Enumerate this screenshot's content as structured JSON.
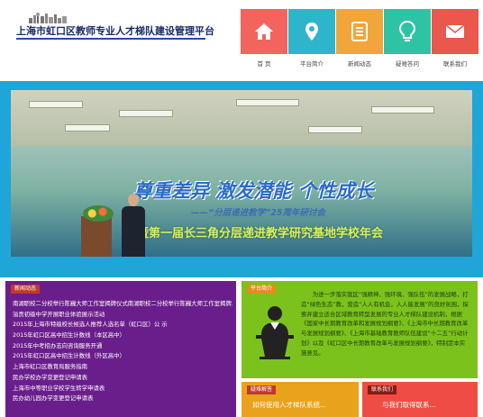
{
  "header": {
    "title": "上海市虹口区教师专业人才梯队建设管理平台"
  },
  "nav": [
    {
      "label": "首 页",
      "icon": "home-icon",
      "color": "#f4645f"
    },
    {
      "label": "平台简介",
      "icon": "location-pin-icon",
      "color": "#2fb5c9"
    },
    {
      "label": "新闻动态",
      "icon": "document-icon",
      "color": "#f2a53a"
    },
    {
      "label": "疑难答问",
      "icon": "lightbulb-icon",
      "color": "#2fc3a6"
    },
    {
      "label": "联系我们",
      "icon": "envelope-icon",
      "color": "#e9574d"
    }
  ],
  "banner": {
    "slogan": "尊重差异 激发潜能 个性成长",
    "subtitle": "——“分层递进教学”25周年研讨会",
    "line3": "暨第一届长三角分层递进教学研究基地学校年会"
  },
  "news": {
    "tag": "新闻动态",
    "items": [
      "南湖职校二分校举行陈巍大师工作室揭牌仪式南湖职校二分校举行陈巍大师工作室揭牌...",
      "溢贡初级中学开展职业体验展示活动",
      "2015年上海市特级校长候选人推荐人选名单（虹口区）公 示",
      "2015年虹口区高中招生计数线（本区高中）",
      "2015年中考招办志向咨询服务开通",
      "2015年虹口区高中招生计数线（外区高中）",
      "上海市虹口区教育局服务指南",
      "民办学校办学变更登记申请表",
      "上海市中等职业学校学生转学申请表",
      "民办幼儿园办学变更登记申请表"
    ]
  },
  "intro": {
    "tag": "平台简介",
    "text": "为进一步落实我区“强精神、强环境、强队伍”的发展战略，打造“绿色生态”教，营造“人人有机会，人人能发展”的良好氛围，探索并建立适合区域教育转型发展的专业人才梯队建设机制，根据《国家中长期教育改革和发展规划纲要》、《上海市中长期教育改革与发展规划纲要》、《上海市基础教育教师队伍建设“十二五”行动计划》以及《虹口区中长期教育改革与发展规划纲要》，特制定本实施意见。"
  },
  "hot": {
    "tag": "疑难解答",
    "text": "如何使用人才梯队系统..."
  },
  "contact": {
    "tag": "联系我们",
    "text": "与我们取得联系..."
  }
}
